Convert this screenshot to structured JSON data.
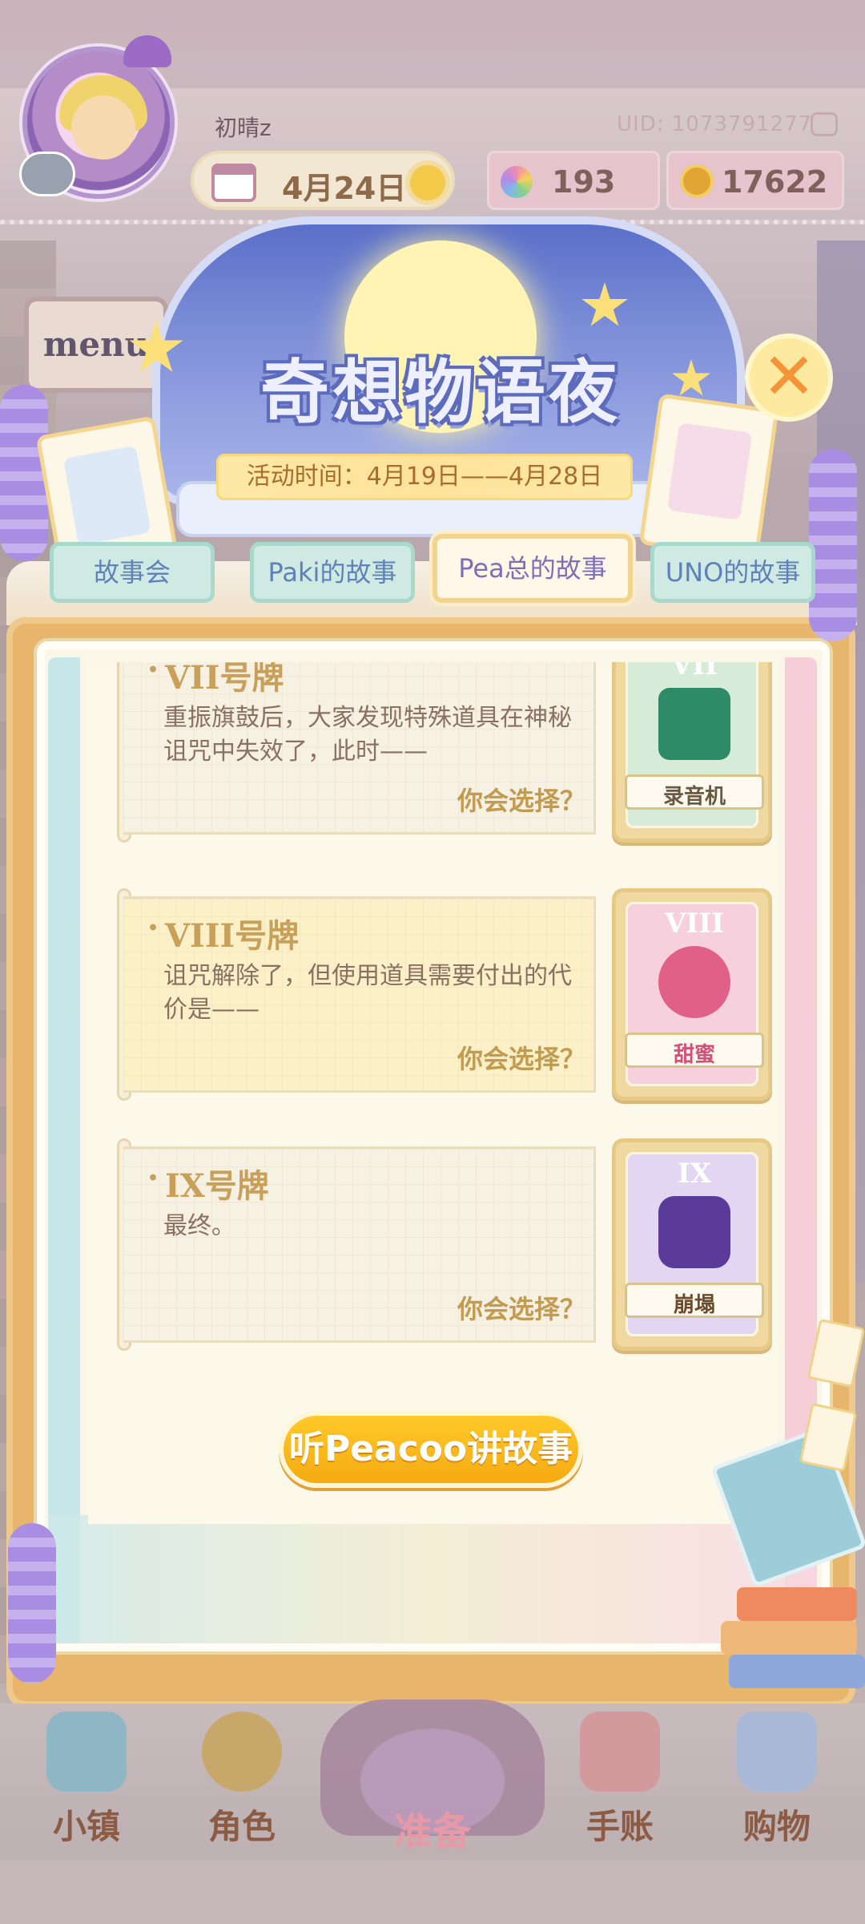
{
  "header": {
    "username": "初晴z",
    "uid": "UID: 1073791277",
    "date": "4月24日",
    "gems": "193",
    "coins": "17622",
    "icons": {
      "calendar": "calendar-icon",
      "weather": "sun-icon",
      "gem": "rainbow-flower-icon",
      "coin": "gold-coin-icon",
      "copy": "copy-icon"
    }
  },
  "event": {
    "title": "奇想物语夜",
    "time": "活动时间：4月19日——4月28日",
    "close_icon": "close-icon",
    "menu_sign": "menu"
  },
  "tabs": [
    {
      "label": "故事会",
      "active": false
    },
    {
      "label": "Paki的故事",
      "active": false
    },
    {
      "label": "Pea总的故事",
      "active": true
    },
    {
      "label": "UNO的故事",
      "active": false
    }
  ],
  "stories": [
    {
      "title": "VII号牌",
      "text": "重振旗鼓后，大家发现特殊道具在神秘诅咒中失效了，此时——",
      "choice": "你会选择？",
      "card_num": "VII",
      "card_label": "录音机",
      "card_color": "#2f8a68",
      "card_bg": "#d6ecd9",
      "highlight": false
    },
    {
      "title": "VIII号牌",
      "text": "诅咒解除了，但使用道具需要付出的代价是——",
      "choice": "你会选择？",
      "card_num": "VIII",
      "card_label": "甜蜜",
      "card_color": "#e0608a",
      "card_bg": "#f6d0dc",
      "highlight": true
    },
    {
      "title": "IX号牌",
      "text": "最终。",
      "choice": "你会选择？",
      "card_num": "IX",
      "card_label": "崩塌",
      "card_color": "#5a3b99",
      "card_bg": "#e2d6f3",
      "highlight": false
    }
  ],
  "listen_button": "听Peacoo讲故事",
  "nav": [
    {
      "label": "小镇",
      "icon": "map-icon",
      "active": false
    },
    {
      "label": "角色",
      "icon": "character-icon",
      "active": false
    },
    {
      "label": "准备",
      "icon": "hat-icon",
      "active": true
    },
    {
      "label": "手账",
      "icon": "journal-icon",
      "active": false
    },
    {
      "label": "购物",
      "icon": "shopping-bag-icon",
      "active": false
    }
  ],
  "colors": {
    "accent": "#f6aa12",
    "tab_active_border": "#f2d48d",
    "tab_border": "#a9d8cc",
    "title_blue": "#5d6bbd",
    "nav_text": "#8b5b44",
    "nav_active": "#e79aa6"
  }
}
